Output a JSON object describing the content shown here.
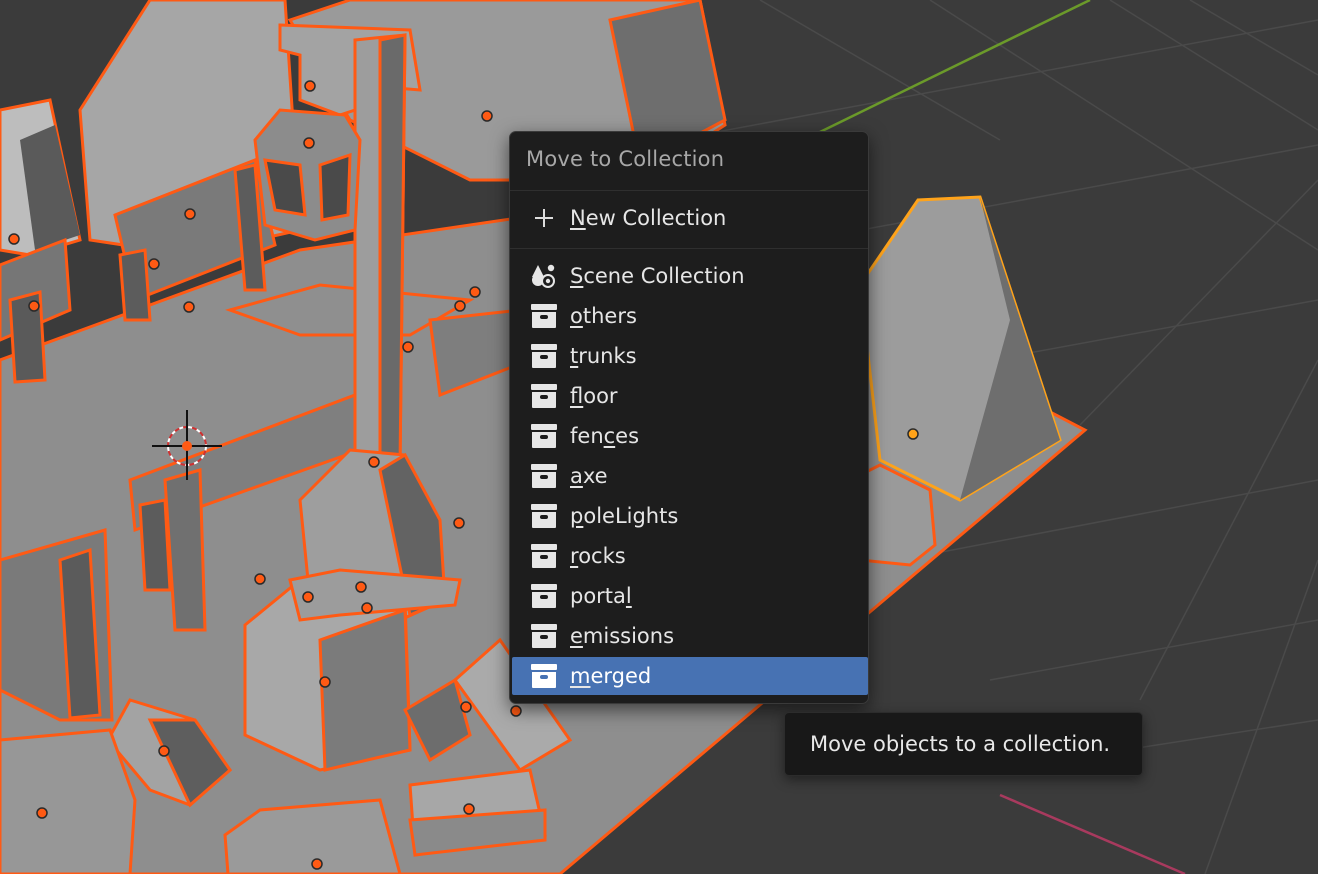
{
  "menu": {
    "title": "Move to Collection",
    "new_collection": {
      "icon": "plus-icon",
      "prefix": "",
      "underline": "N",
      "rest": "ew Collection"
    },
    "scene_collection": {
      "icon": "scene-collection-icon",
      "prefix": "",
      "underline": "S",
      "rest": "cene Collection"
    },
    "collections": [
      {
        "name": "others",
        "icon": "collection-box-icon",
        "prefix": "",
        "underline": "o",
        "rest": "thers"
      },
      {
        "name": "trunks",
        "icon": "collection-box-icon",
        "prefix": "",
        "underline": "t",
        "rest": "runks"
      },
      {
        "name": "floor",
        "icon": "collection-box-icon",
        "prefix": "",
        "underline": "f",
        "rest": "loor"
      },
      {
        "name": "fences",
        "icon": "collection-box-icon",
        "prefix": "fen",
        "underline": "c",
        "rest": "es"
      },
      {
        "name": "axe",
        "icon": "collection-box-icon",
        "prefix": "",
        "underline": "a",
        "rest": "xe"
      },
      {
        "name": "poleLights",
        "icon": "collection-box-icon",
        "prefix": "",
        "underline": "p",
        "rest": "oleLights"
      },
      {
        "name": "rocks",
        "icon": "collection-box-icon",
        "prefix": "",
        "underline": "r",
        "rest": "ocks"
      },
      {
        "name": "portal",
        "icon": "collection-box-icon",
        "prefix": "porta",
        "underline": "l",
        "rest": ""
      },
      {
        "name": "emissions",
        "icon": "collection-box-icon",
        "prefix": "",
        "underline": "e",
        "rest": "missions"
      },
      {
        "name": "merged",
        "icon": "collection-box-icon",
        "prefix": "",
        "underline": "m",
        "rest": "erged",
        "highlighted": true
      }
    ]
  },
  "tooltip": {
    "text": "Move objects to a collection."
  },
  "colors": {
    "viewport_bg": "#3b3b3b",
    "grid_line": "#474747",
    "y_axis": "#6b9a2a",
    "x_axis": "#a83a5e",
    "selection_outline": "#ff5a14",
    "active_outline": "#ffa31a",
    "menu_bg": "#1d1d1d",
    "menu_highlight": "#4772b3"
  }
}
